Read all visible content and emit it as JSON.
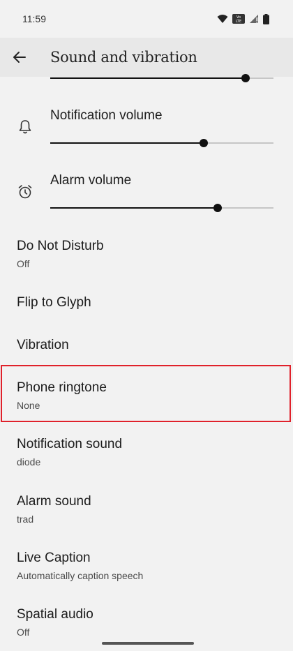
{
  "status_bar": {
    "time": "11:59",
    "icons": [
      "wifi-icon",
      "volte-icon",
      "signal-icon",
      "battery-icon"
    ],
    "volte_text": "Vo LTE"
  },
  "app_bar": {
    "title": "Sound and vibration",
    "back_icon": "arrow-back-icon"
  },
  "volume": {
    "media_level": 0.875,
    "notification": {
      "label": "Notification volume",
      "level": 0.6875,
      "icon": "bell-icon"
    },
    "alarm": {
      "label": "Alarm volume",
      "level": 0.75,
      "icon": "alarm-clock-icon"
    }
  },
  "items": [
    {
      "title": "Do Not Disturb",
      "subtitle": "Off"
    },
    {
      "title": "Flip to Glyph",
      "subtitle": ""
    },
    {
      "title": "Vibration",
      "subtitle": ""
    },
    {
      "title": "Phone ringtone",
      "subtitle": "None"
    },
    {
      "title": "Notification sound",
      "subtitle": "diode"
    },
    {
      "title": "Alarm sound",
      "subtitle": "trad"
    },
    {
      "title": "Live Caption",
      "subtitle": "Automatically caption speech"
    },
    {
      "title": "Spatial audio",
      "subtitle": "Off"
    }
  ],
  "colors": {
    "highlight": "#e0212b",
    "background": "#f2f2f2",
    "slider_active": "#111111",
    "slider_inactive": "#c6c6c6"
  }
}
